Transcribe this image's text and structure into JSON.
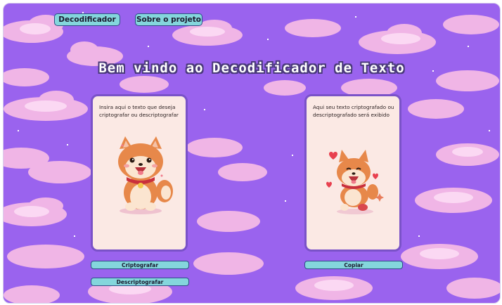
{
  "nav": {
    "decoder_label": "Decodificador",
    "about_label": "Sobre o projeto"
  },
  "header": {
    "title": "Bem vindo ao Decodificador de Texto"
  },
  "input_card": {
    "placeholder_text": "Insira aqui o texto que deseja criptografar ou descriptografar",
    "illustration": "shiba-dog-icon"
  },
  "output_card": {
    "message": "Aqui seu texto criptografado ou descriptografado será exibido",
    "illustration": "shiba-dog-hearts-icon"
  },
  "actions": {
    "encrypt_label": "Criptografar",
    "decrypt_label": "Descriptografar",
    "copy_label": "Copiar"
  },
  "colors": {
    "background": "#9a63ee",
    "button": "#84d6dc",
    "card": "#fbe9e4",
    "card_border": "#7a52c8"
  }
}
